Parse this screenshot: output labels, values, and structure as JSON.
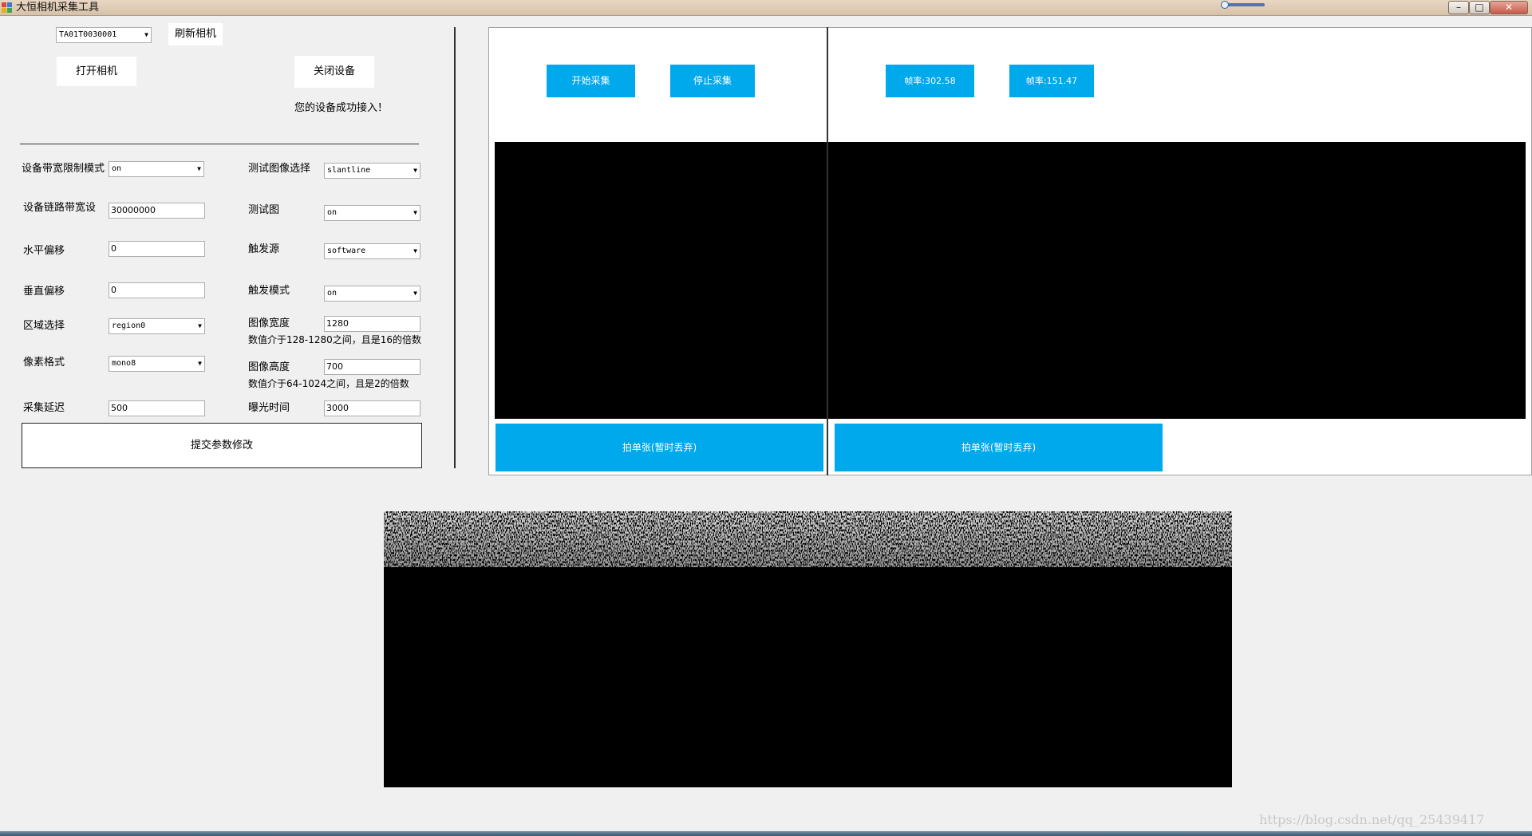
{
  "window": {
    "title": "大恒相机采集工具",
    "min_label": "–",
    "max_label": "□",
    "close_label": "✕"
  },
  "camera": {
    "selected": "TA01T0030001",
    "refresh_label": "刷新相机",
    "open_label": "打开相机",
    "close_device_label": "关闭设备",
    "status": "您的设备成功接入！"
  },
  "params": {
    "bandwidth_mode": {
      "label": "设备带宽限制模式",
      "value": "on"
    },
    "link_bandwidth": {
      "label": "设备链路带宽设",
      "value": "30000000"
    },
    "offset_x": {
      "label": "水平偏移",
      "value": "0"
    },
    "offset_y": {
      "label": "垂直偏移",
      "value": "0"
    },
    "region": {
      "label": "区域选择",
      "value": "region0"
    },
    "pixel_format": {
      "label": "像素格式",
      "value": "mono8"
    },
    "acq_delay": {
      "label": "采集延迟",
      "value": "500"
    },
    "test_image_select": {
      "label": "测试图像选择",
      "value": "slantline"
    },
    "test_image": {
      "label": "测试图",
      "value": "on"
    },
    "trigger_source": {
      "label": "触发源",
      "value": "software"
    },
    "trigger_mode": {
      "label": "触发模式",
      "value": "on"
    },
    "width": {
      "label": "图像宽度",
      "value": "1280",
      "hint": "数值介于128-1280之间，且是16的倍数"
    },
    "height": {
      "label": "图像高度",
      "value": "700",
      "hint": "数值介于64-1024之间，且是2的倍数"
    },
    "exposure": {
      "label": "曝光时间",
      "value": "3000"
    },
    "submit_label": "提交参数修改"
  },
  "capture": {
    "start_label": "开始采集",
    "stop_label": "停止采集",
    "fps1": "帧率:302.58",
    "fps2": "帧率:151.47",
    "snap1_label": "拍单张(暂时丢弃)",
    "snap2_label": "拍单张(暂时丢弃)"
  },
  "watermark": "https://blog.csdn.net/qq_25439417"
}
